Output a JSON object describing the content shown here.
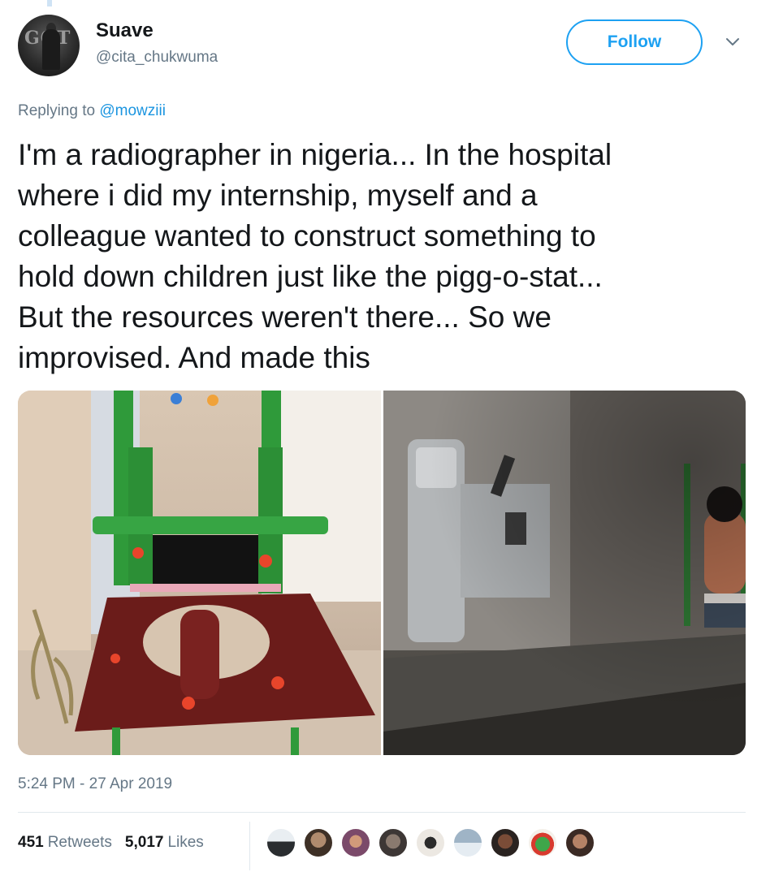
{
  "user": {
    "display_name": "Suave",
    "handle": "@cita_chukwuma",
    "avatar_seal_text": "GOT"
  },
  "header": {
    "follow_label": "Follow"
  },
  "reply": {
    "prefix": "Replying to ",
    "mention": "@mowziii"
  },
  "tweet": {
    "text": "I'm a radiographer in nigeria... In the hospital\nwhere i did my internship,  myself and a\ncolleague wanted to construct something to\nhold down children just like the pigg-o-stat...\nBut the resources weren't there... So we\nimprovised. And made this"
  },
  "meta": {
    "timestamp": "5:24 PM - 27 Apr 2019"
  },
  "stats": {
    "retweets_count": "451",
    "retweets_label": "Retweets",
    "likes_count": "5,017",
    "likes_label": "Likes"
  },
  "colors": {
    "accent": "#1da1f2",
    "mention": "#1b95e0",
    "secondary_text": "#657786",
    "divider": "#e1e8ed"
  },
  "icons": {
    "caret": "chevron-down-icon"
  }
}
